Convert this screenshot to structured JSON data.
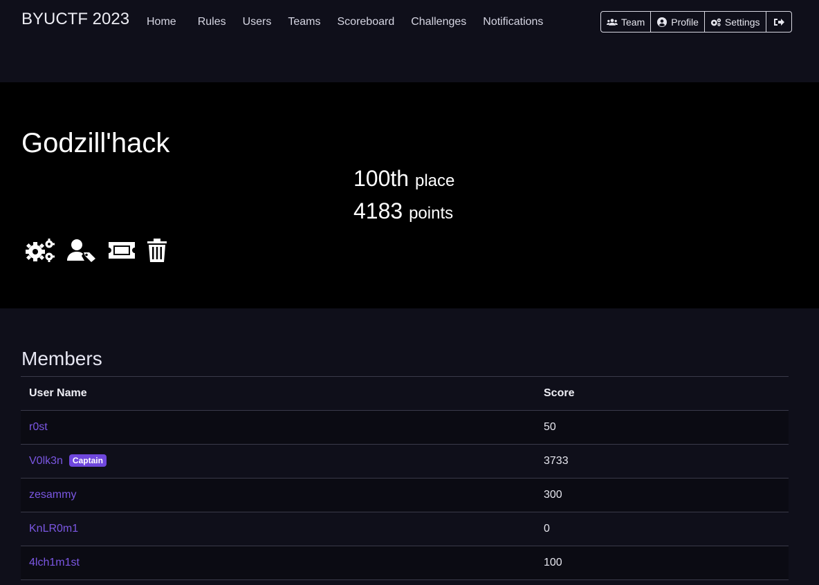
{
  "nav": {
    "brand": "BYUCTF 2023",
    "links": [
      "Home",
      "Rules",
      "Users",
      "Teams",
      "Scoreboard",
      "Challenges",
      "Notifications"
    ],
    "buttons": {
      "team": "Team",
      "profile": "Profile",
      "settings": "Settings"
    }
  },
  "team": {
    "name": "Godzill'hack",
    "place_value": "100th",
    "place_unit": "place",
    "points_value": "4183",
    "points_unit": "points"
  },
  "members": {
    "title": "Members",
    "headers": {
      "name": "User Name",
      "score": "Score"
    },
    "rows": [
      {
        "name": "r0st",
        "score": "50"
      },
      {
        "name": "V0lk3n",
        "badge": "Captain",
        "score": "3733"
      },
      {
        "name": "zesammy",
        "score": "300"
      },
      {
        "name": "KnLR0m1",
        "score": "0"
      },
      {
        "name": "4lch1m1st",
        "score": "100"
      }
    ]
  }
}
